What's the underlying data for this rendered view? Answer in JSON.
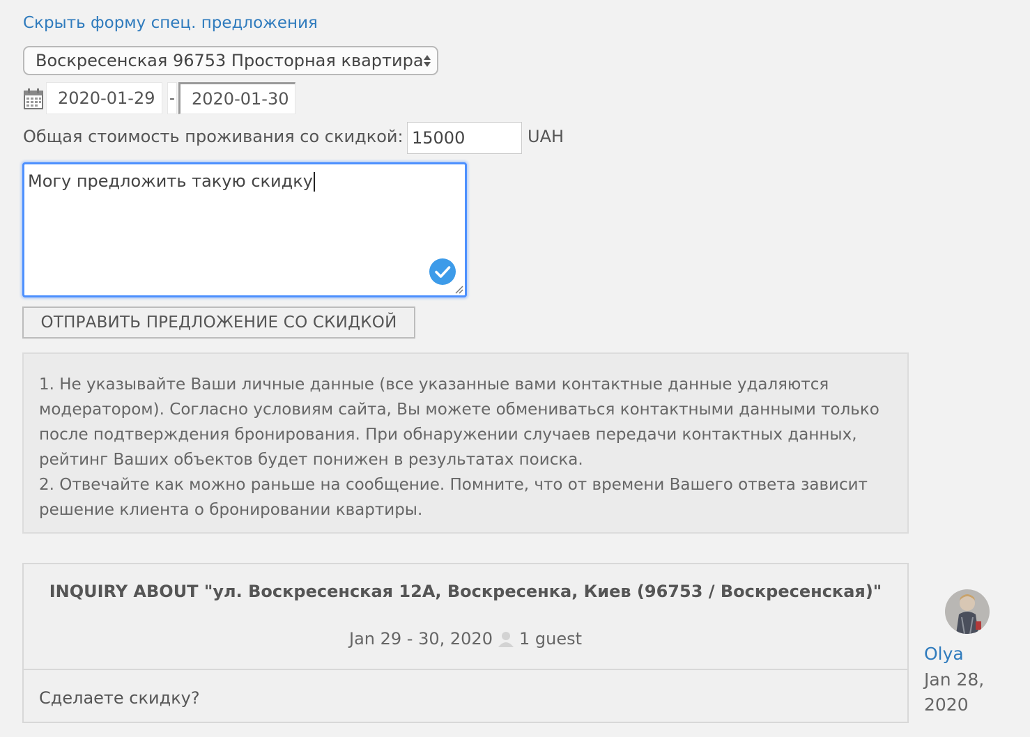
{
  "links": {
    "hide_special_offer": "Скрыть форму спец. предложения"
  },
  "listing_select": {
    "selected": "Воскресенская 96753 Просторная квартира"
  },
  "dates": {
    "from": "2020-01-29",
    "separator": "-",
    "to": "2020-01-30"
  },
  "price": {
    "label": "Общая стоимость проживания со скидкой:",
    "value": "15000",
    "currency": "UAH"
  },
  "message": {
    "value": "Могу предложить такую скидку"
  },
  "send_button": {
    "label": "ОТПРАВИТЬ ПРЕДЛОЖЕНИЕ СО СКИДКОЙ"
  },
  "notice": {
    "line1": "1. Не указывайте Ваши личные данные (все указанные вами контактные данные удаляются модератором). Согласно условиям сайта, Вы можете обмениваться контактными данными только после подтверждения бронирования. При обнаружении случаев передачи контактных данных, рейтинг Ваших объектов будет понижен в результатах поиска.",
    "line2": "2. Отвечайте как можно раньше на сообщение. Помните, что от времени Вашего ответа зависит решение клиента о бронировании квартиры."
  },
  "inquiry": {
    "title": "INQUIRY ABOUT \"ул. Воскресенская 12А, Воскресенка, Киев (96753 / Воскресенская)\"",
    "dates": "Jan 29 - 30, 2020",
    "guests": "1 guest",
    "message": "Сделаете скидку?"
  },
  "user": {
    "name": "Olya",
    "date": "Jan 28, 2020"
  },
  "colors": {
    "link": "#2f7bbd",
    "focus": "#4d90fe",
    "check": "#3d9be9"
  }
}
